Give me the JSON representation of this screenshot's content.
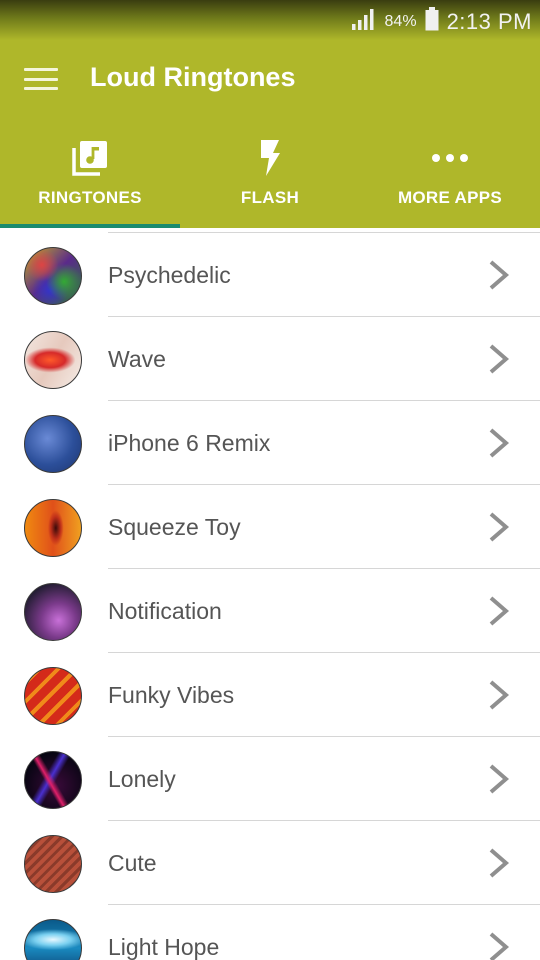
{
  "status_bar": {
    "battery_percent": "84%",
    "time": "2:13 PM",
    "icons": [
      "signal-icon",
      "battery-icon"
    ]
  },
  "app_bar": {
    "title": "Loud Ringtones",
    "menu_icon": "hamburger-menu-icon",
    "color": "#afb72a"
  },
  "tabs": [
    {
      "label": "RINGTONES",
      "icon": "music-library-icon",
      "selected": true
    },
    {
      "label": "FLASH",
      "icon": "flash-icon",
      "selected": false
    },
    {
      "label": "MORE APPS",
      "icon": "more-dots-icon",
      "selected": false
    }
  ],
  "tab_indicator_color": "#1a8b6e",
  "ringtones": [
    {
      "name": "Psychedelic"
    },
    {
      "name": "Wave"
    },
    {
      "name": "iPhone 6 Remix"
    },
    {
      "name": "Squeeze Toy"
    },
    {
      "name": "Notification"
    },
    {
      "name": "Funky Vibes"
    },
    {
      "name": "Lonely"
    },
    {
      "name": "Cute"
    },
    {
      "name": "Light Hope"
    }
  ],
  "row_chevron_icon": "chevron-right-icon"
}
